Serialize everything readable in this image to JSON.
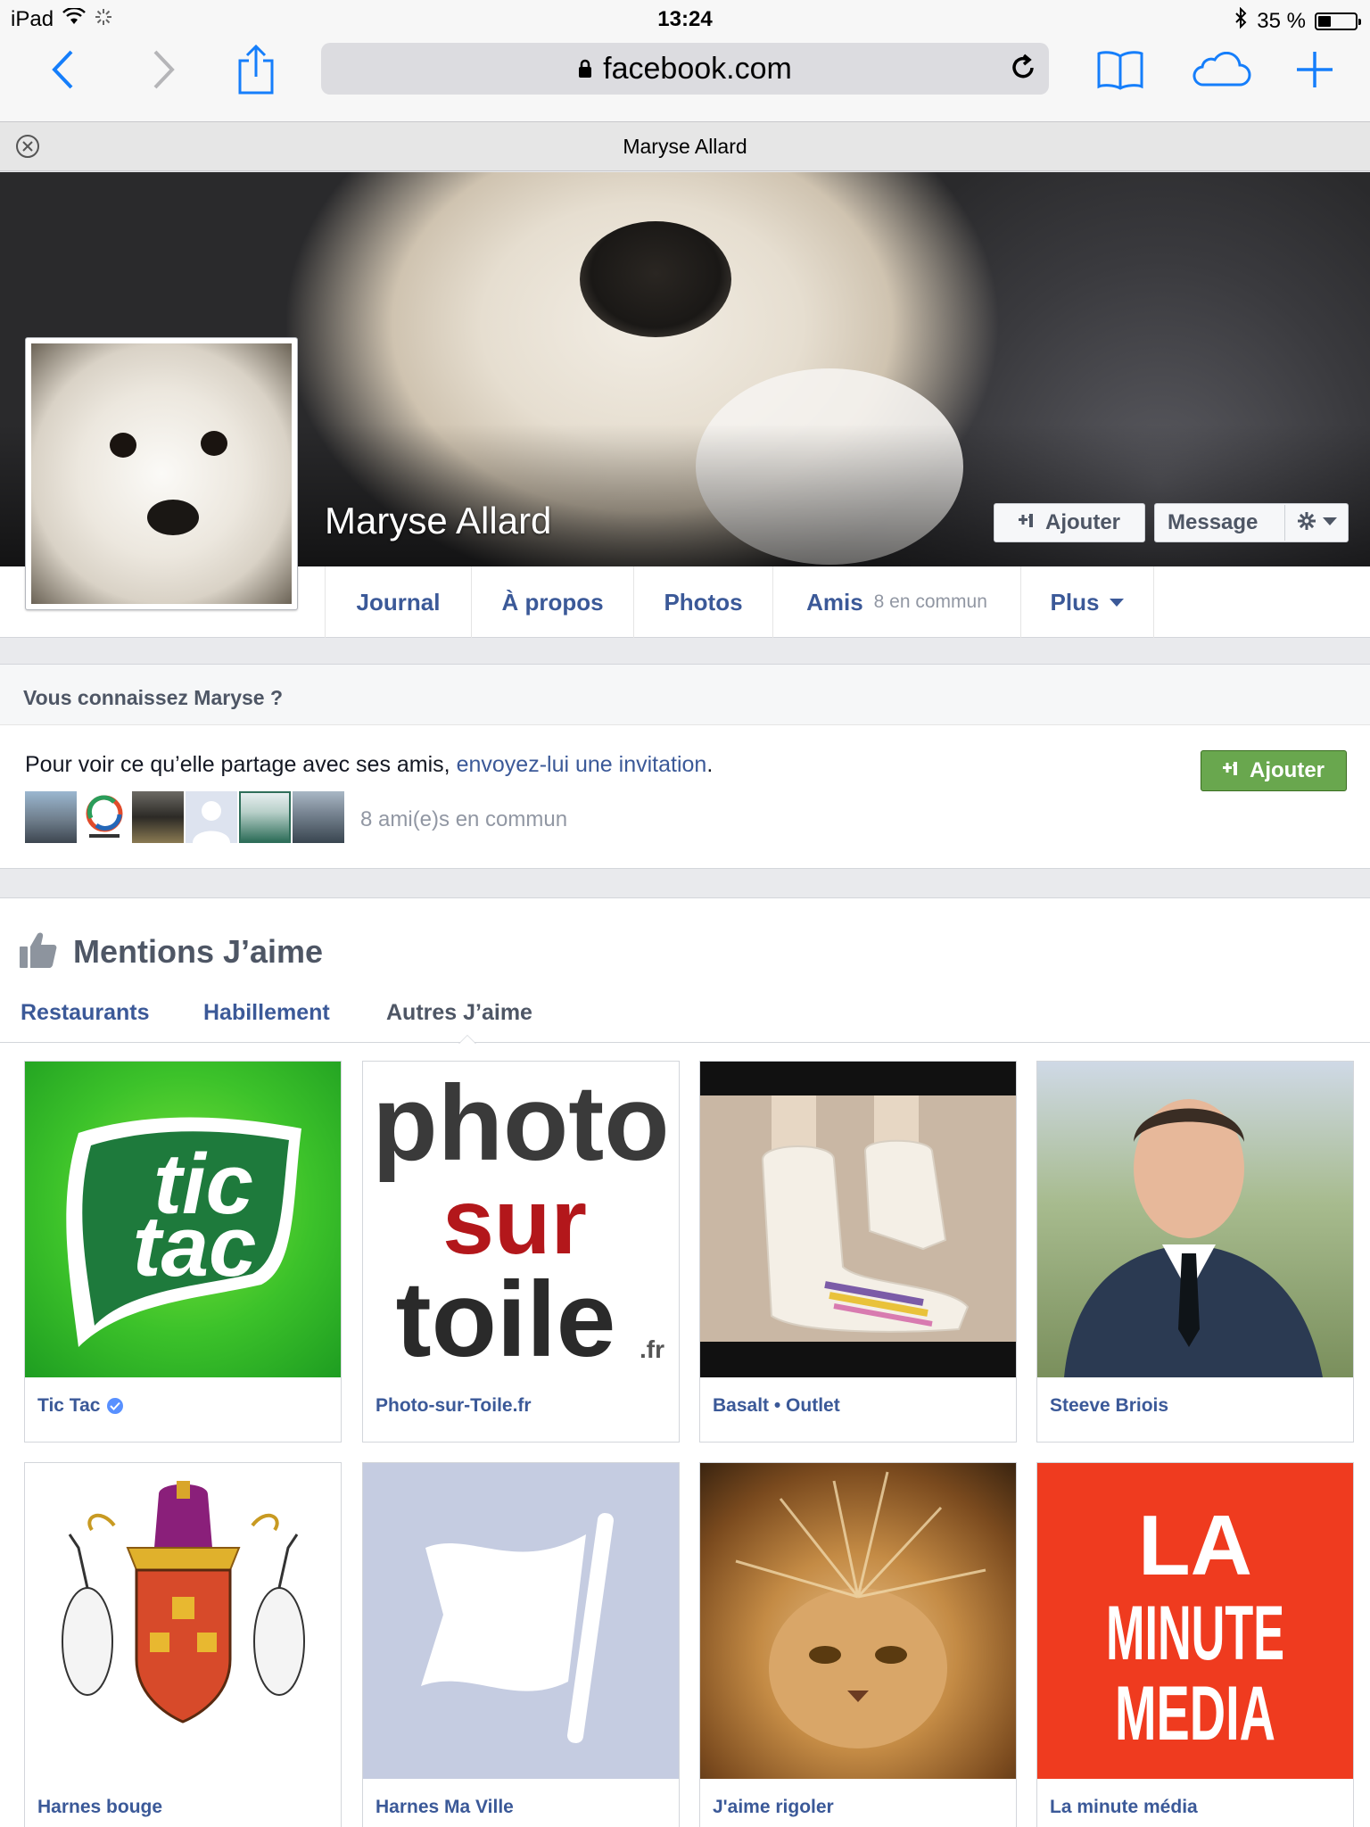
{
  "status_bar": {
    "device": "iPad",
    "time": "13:24",
    "battery": "35 %",
    "battery_level": 0.35
  },
  "browser": {
    "url": "facebook.com",
    "tab_title": "Maryse Allard"
  },
  "profile": {
    "name": "Maryse Allard",
    "add_button": "Ajouter",
    "message_button": "Message"
  },
  "nav": {
    "tabs": [
      {
        "label": "Journal"
      },
      {
        "label": "À propos"
      },
      {
        "label": "Photos"
      },
      {
        "label": "Amis",
        "sub": "8 en commun"
      },
      {
        "label": "Plus"
      }
    ]
  },
  "know_card": {
    "heading": "Vous connaissez Maryse ?",
    "text_before": "Pour voir ce qu’elle partage avec ses amis, ",
    "link": "envoyez-lui une invitation",
    "text_after": ".",
    "add_button": "Ajouter",
    "mutual_friends": "8 ami(e)s en commun"
  },
  "likes": {
    "title": "Mentions J’aime",
    "tabs": [
      {
        "label": "Restaurants"
      },
      {
        "label": "Habillement"
      },
      {
        "label": "Autres J’aime",
        "active": true
      }
    ],
    "items": [
      {
        "name": "Tic Tac",
        "verified": true
      },
      {
        "name": "Photo-sur-Toile.fr"
      },
      {
        "name": "Basalt • Outlet"
      },
      {
        "name": "Steeve Briois"
      },
      {
        "name": "Harnes bouge"
      },
      {
        "name": "Harnes Ma Ville"
      },
      {
        "name": "J'aime rigoler"
      },
      {
        "name": "La minute média"
      }
    ],
    "logo_text": {
      "tictac_1": "tic",
      "tictac_2": "tac",
      "pst_1": "photo",
      "pst_2": "sur",
      "pst_3": "toile",
      "pst_4": ".fr",
      "lmm_1": "LA",
      "lmm_2": "MINUTE",
      "lmm_3": "MEDIA"
    }
  },
  "colors": {
    "facebook_blue": "#3b5998",
    "green_button": "#69a74e",
    "verified_blue": "#5890ff"
  }
}
